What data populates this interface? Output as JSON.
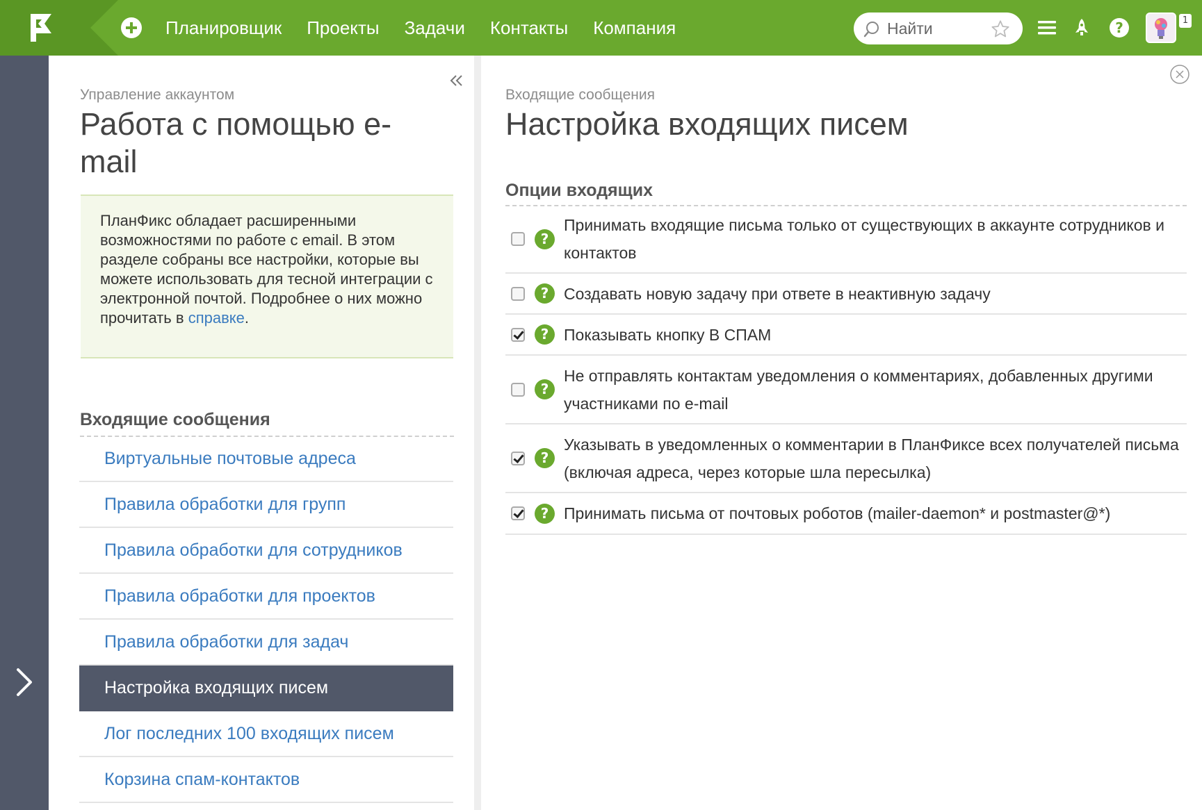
{
  "topbar": {
    "nav": [
      "Планировщик",
      "Проекты",
      "Задачи",
      "Контакты",
      "Компания"
    ],
    "search_placeholder": "Найти",
    "notification_count": "1"
  },
  "left_panel": {
    "subtitle": "Управление аккаунтом",
    "title": "Работа с помощью e-mail",
    "info_text": "ПланФикс обладает расширенными возможностями по работе с email. В этом разделе собраны все настройки, которые вы можете использовать для тесной интеграции с электронной почтой. Подробнее о них можно прочитать в",
    "info_link": "справке",
    "info_end": ".",
    "section_title": "Входящие сообщения",
    "menu": [
      {
        "label": "Виртуальные почтовые адреса",
        "active": false
      },
      {
        "label": "Правила обработки для групп",
        "active": false
      },
      {
        "label": "Правила обработки для сотрудников",
        "active": false
      },
      {
        "label": "Правила обработки для проектов",
        "active": false
      },
      {
        "label": "Правила обработки для задач",
        "active": false
      },
      {
        "label": "Настройка входящих писем",
        "active": true
      },
      {
        "label": "Лог последних 100 входящих писем",
        "active": false
      },
      {
        "label": "Корзина спам-контактов",
        "active": false
      }
    ]
  },
  "right_panel": {
    "subtitle": "Входящие сообщения",
    "title": "Настройка входящих писем",
    "section_title": "Опции входящих",
    "options": [
      {
        "label": "Принимать входящие письма только от существующих в аккаунте сотрудников и контактов",
        "checked": false
      },
      {
        "label": "Создавать новую задачу при ответе в неактивную задачу",
        "checked": false
      },
      {
        "label": "Показывать кнопку В СПАМ",
        "checked": true
      },
      {
        "label": "Не отправлять контактам уведомления о комментариях, добавленных другими участниками по e-mail",
        "checked": false
      },
      {
        "label": "Указывать в уведомленных о комментарии в ПланФиксе всех получателей письма (включая адреса, через которые шла пересылка)",
        "checked": true
      },
      {
        "label": "Принимать письма от почтовых роботов (mailer-daemon* и postmaster@*)",
        "checked": true
      }
    ]
  },
  "colors": {
    "brand_green": "#6aa92e",
    "sidebar_dark": "#515869",
    "link_blue": "#3a7bbf"
  }
}
